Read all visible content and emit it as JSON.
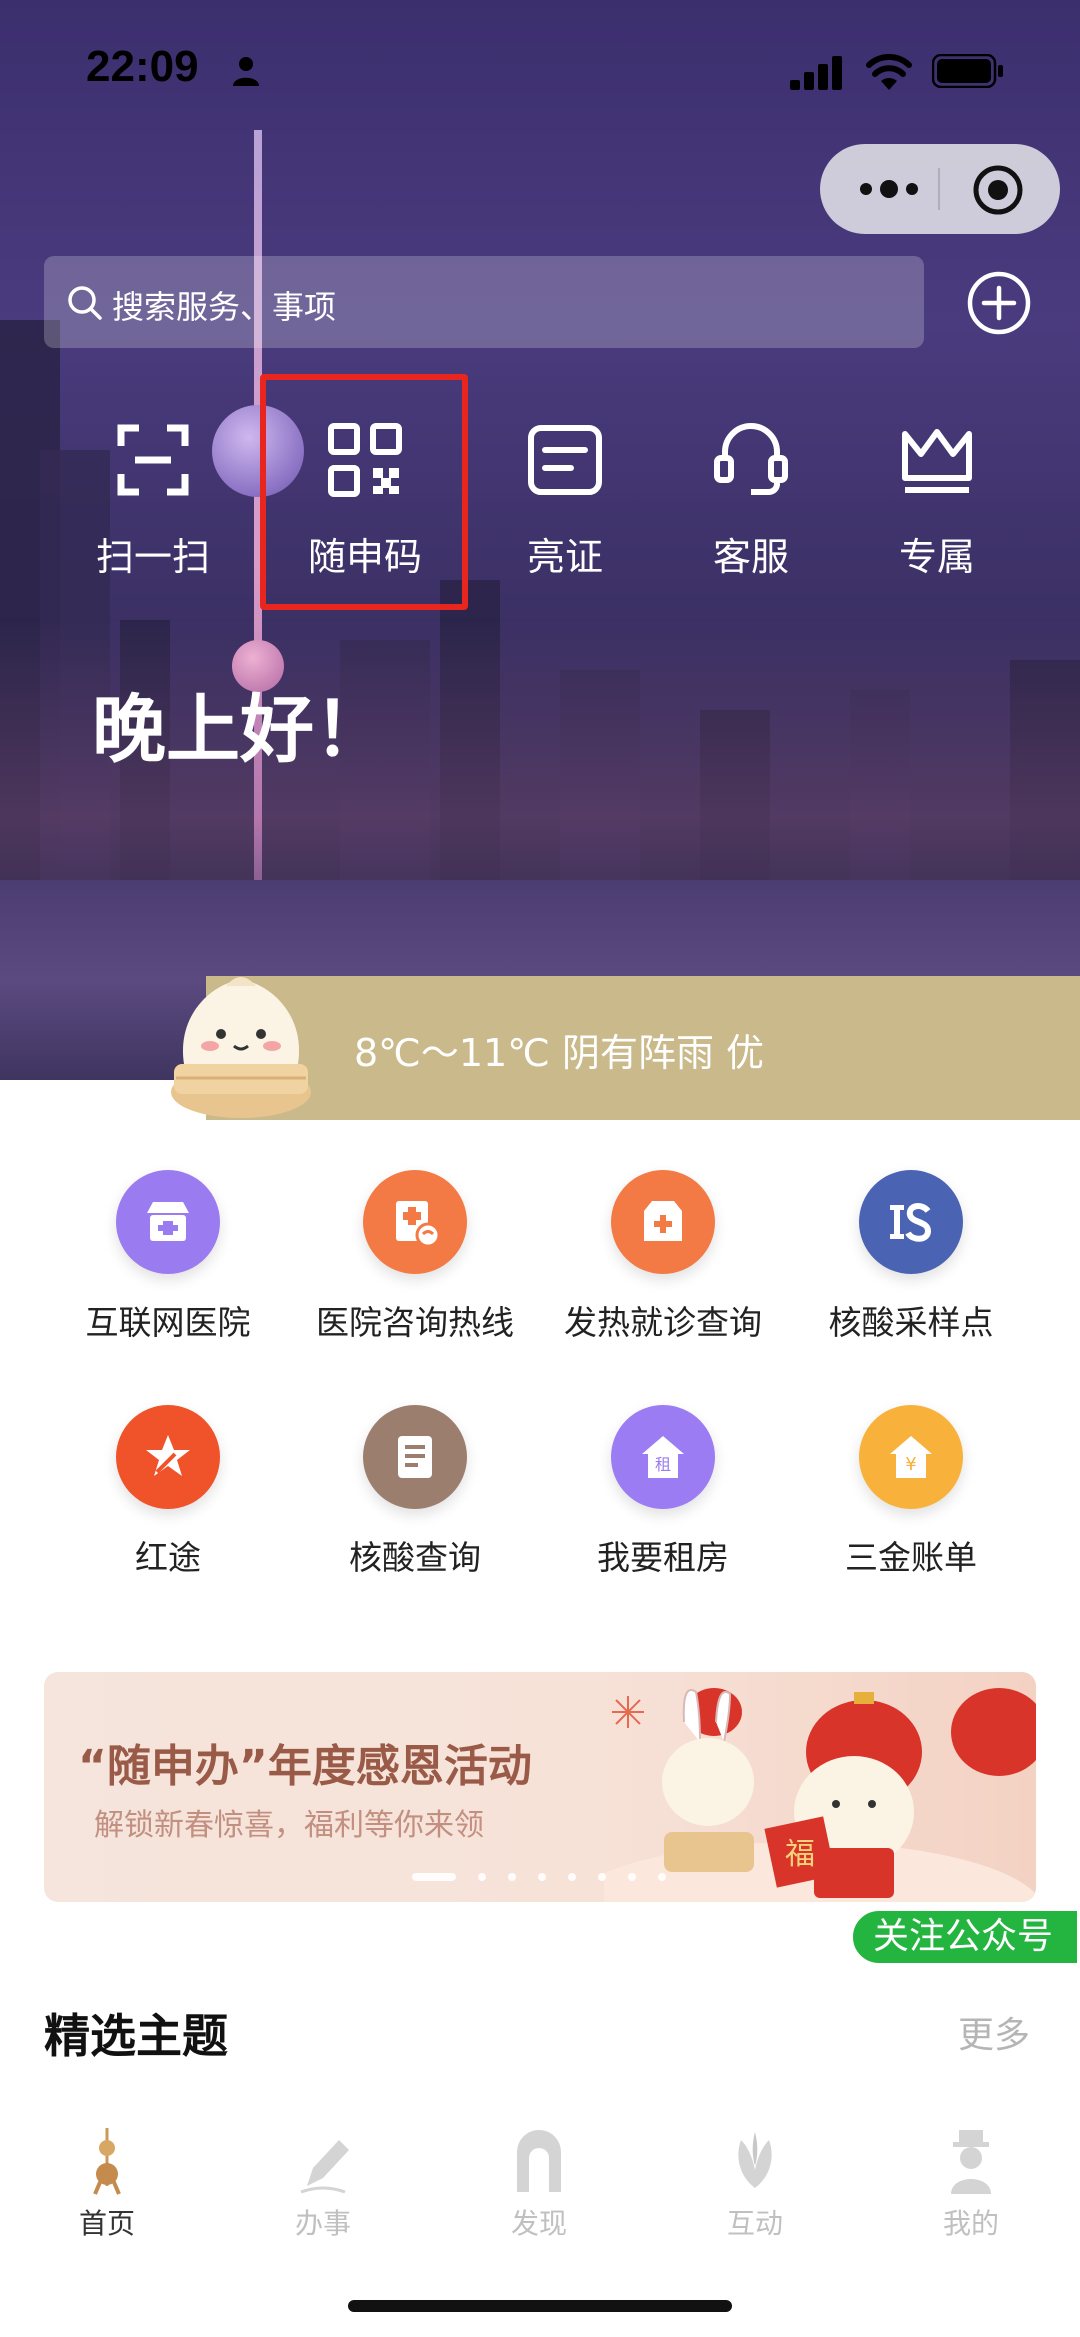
{
  "status_bar": {
    "time": "22:09"
  },
  "search": {
    "placeholder": "搜索服务、事项"
  },
  "quick_actions": [
    {
      "label": "扫一扫",
      "icon": "scan-icon"
    },
    {
      "label": "随申码",
      "icon": "qr-code-icon"
    },
    {
      "label": "亮证",
      "icon": "certificate-icon"
    },
    {
      "label": "客服",
      "icon": "headset-icon"
    },
    {
      "label": "专属",
      "icon": "crown-icon"
    }
  ],
  "greeting": "晚上好！",
  "weather": {
    "text": "8℃～11℃ 阴有阵雨 优"
  },
  "services": [
    {
      "label": "互联网医院",
      "icon": "hospital-store-icon",
      "color": "#9a7cf0"
    },
    {
      "label": "医院咨询热线",
      "icon": "hotline-icon",
      "color": "#f47a45"
    },
    {
      "label": "发热就诊查询",
      "icon": "medical-box-icon",
      "color": "#f47a45"
    },
    {
      "label": "核酸采样点",
      "icon": "sampling-point-icon",
      "color": "#4a64b3"
    },
    {
      "label": "红途",
      "icon": "red-star-icon",
      "color": "#f0522a"
    },
    {
      "label": "核酸查询",
      "icon": "document-icon",
      "color": "#9b7e6e"
    },
    {
      "label": "我要租房",
      "icon": "rent-house-icon",
      "color": "#9b7cf2"
    },
    {
      "label": "三金账单",
      "icon": "bill-house-icon",
      "color": "#f8b23c"
    }
  ],
  "banner": {
    "title": "“随申办”年度感恩活动",
    "subtitle": "解锁新春惊喜，福利等你来领",
    "art_text": "福",
    "page_count": 8,
    "active_page": 1
  },
  "follow_button": "关注公众号",
  "featured": {
    "title": "精选主题",
    "more": "更多"
  },
  "tabbar": [
    {
      "label": "首页",
      "icon": "home-tower-icon",
      "active": true
    },
    {
      "label": "办事",
      "icon": "pen-icon",
      "active": false
    },
    {
      "label": "发现",
      "icon": "arch-icon",
      "active": false
    },
    {
      "label": "互动",
      "icon": "flower-icon",
      "active": false
    },
    {
      "label": "我的",
      "icon": "person-hat-icon",
      "active": false
    }
  ]
}
